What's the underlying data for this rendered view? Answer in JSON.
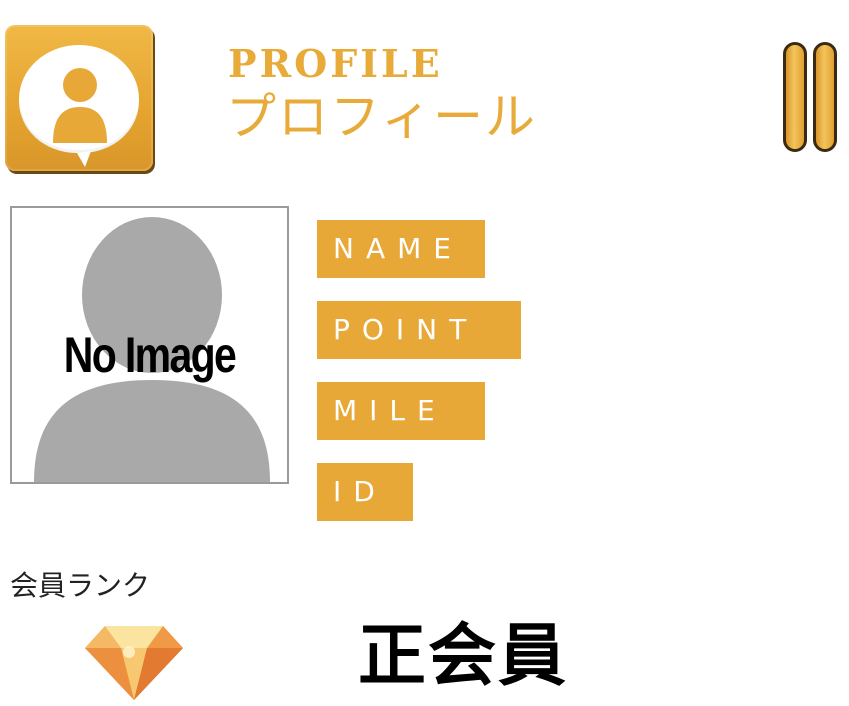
{
  "header": {
    "title_en": "PROFILE",
    "title_ja": "プロフィール",
    "profile_icon": "user-speech-bubble-icon",
    "menu_icon": "pause-icon"
  },
  "avatar": {
    "placeholder_text": "No Image",
    "icon": "person-silhouette-icon"
  },
  "fields": {
    "name_label": "NAME",
    "point_label": "POINT",
    "mile_label": "MILE",
    "id_label": "ID"
  },
  "rank": {
    "heading": "会員ランク",
    "value": "正会員",
    "icon": "diamond-icon"
  },
  "colors": {
    "accent": "#e8a838",
    "accent_dark": "#d9962a",
    "text": "#000000"
  }
}
